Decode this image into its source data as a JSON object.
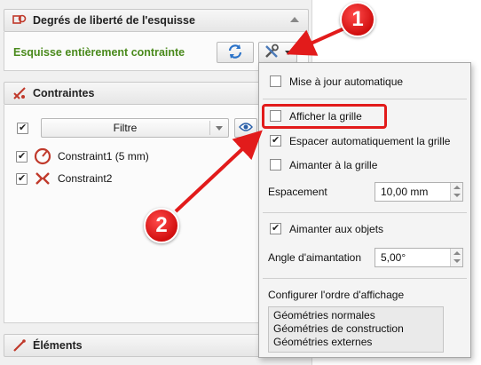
{
  "sections": {
    "dof": {
      "title": "Degrés de liberté de l'esquisse",
      "status": "Esquisse entièrement contrainte"
    },
    "constraints": {
      "title": "Contraintes",
      "filter": "Filtre",
      "items": [
        {
          "label": "Constraint1 (5 mm)",
          "checked": true,
          "icon": "radius-constraint-icon"
        },
        {
          "label": "Constraint2",
          "checked": true,
          "icon": "coincident-constraint-icon"
        }
      ]
    },
    "elements": {
      "title": "Éléments"
    }
  },
  "menu": {
    "auto_update": "Mise à jour automatique",
    "show_grid": "Afficher la grille",
    "auto_grid_spacing": "Espacer automatiquement la grille",
    "snap_grid": "Aimanter à la grille",
    "spacing_label": "Espacement",
    "spacing_value": "10,00 mm",
    "snap_objects": "Aimanter aux objets",
    "snap_angle_label": "Angle d'aimantation",
    "snap_angle_value": "5,00°",
    "order_title": "Configurer l'ordre d'affichage",
    "order_items": [
      "Géométries normales",
      "Géométries de construction",
      "Géométries externes"
    ]
  },
  "annotations": {
    "callout1": "1",
    "callout2": "2"
  },
  "colors": {
    "status_green": "#4a8a1c",
    "annotation_red": "#e21b1b"
  }
}
